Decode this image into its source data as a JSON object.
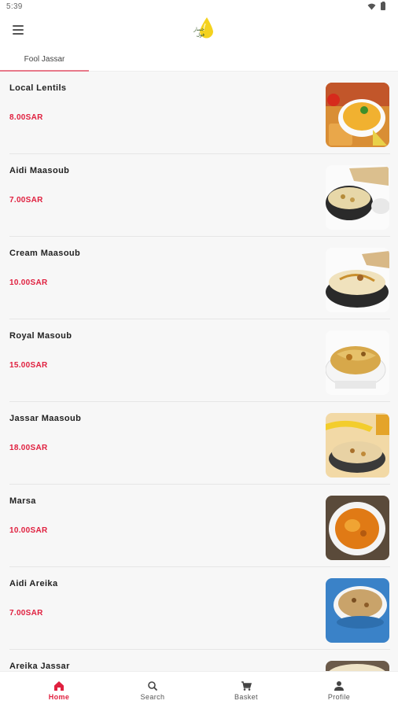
{
  "status_bar": {
    "time": "5:39"
  },
  "app_bar": {
    "logo_text_line1": "جسار",
    "logo_text_line2": "فول"
  },
  "tabs": [
    {
      "label": "Fool Jassar",
      "active": true
    }
  ],
  "items": [
    {
      "name": "Local Lentils",
      "price": "8.00SAR"
    },
    {
      "name": "Aidi Maasoub",
      "price": "7.00SAR"
    },
    {
      "name": "Cream Maasoub",
      "price": "10.00SAR"
    },
    {
      "name": "Royal Masoub",
      "price": "15.00SAR"
    },
    {
      "name": "Jassar Maasoub",
      "price": "18.00SAR"
    },
    {
      "name": "Marsa",
      "price": "10.00SAR"
    },
    {
      "name": "Aidi Areika",
      "price": "7.00SAR"
    },
    {
      "name": "Areika Jassar",
      "price": ""
    }
  ],
  "bottom_nav": [
    {
      "label": "Home",
      "icon": "home-icon",
      "active": true
    },
    {
      "label": "Search",
      "icon": "search-icon",
      "active": false
    },
    {
      "label": "Basket",
      "icon": "cart-icon",
      "active": false
    },
    {
      "label": "Profile",
      "icon": "person-icon",
      "active": false
    }
  ],
  "colors": {
    "accent": "#e0203f",
    "tab_indicator": "#e8798a",
    "list_bg": "#f7f7f7"
  }
}
